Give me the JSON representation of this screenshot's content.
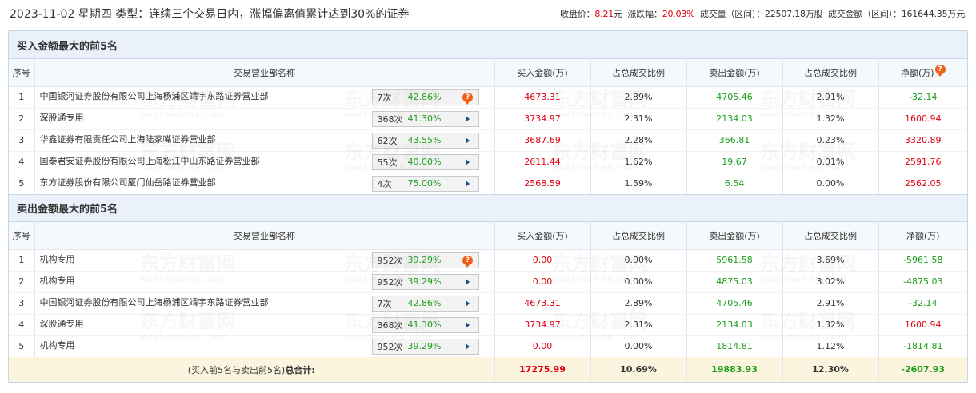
{
  "header": {
    "left_text": "2023-11-02 星期四 类型：连续三个交易日内，涨幅偏离值累计达到30%的证券",
    "close_label": "收盘价：",
    "close_value": "8.21",
    "close_unit": "元",
    "change_label": "涨跌幅：",
    "change_value": "20.03%",
    "volume_text": "成交量（区间）：22507.18万股",
    "turnover_text": "成交金额（区间）：161644.35万元"
  },
  "buy_section": {
    "title": "买入金额最大的前5名",
    "columns": [
      "序号",
      "交易营业部名称",
      "买入金额(万)",
      "占总成交比例",
      "卖出金额(万)",
      "占总成交比例",
      "净额(万)"
    ],
    "rows": [
      {
        "seq": "1",
        "name": "中国银河证券股份有限公司上海杨浦区靖宇东路证券营业部",
        "count": "7次",
        "rate": "42.86%",
        "icon": "question-bubble-icon",
        "buy": "4673.31",
        "buy_pct": "2.89%",
        "sell": "4705.46",
        "sell_pct": "2.91%",
        "net": "-32.14"
      },
      {
        "seq": "2",
        "name": "深股通专用",
        "count": "368次",
        "rate": "41.30%",
        "icon": "arrow-right-icon",
        "buy": "3734.97",
        "buy_pct": "2.31%",
        "sell": "2134.03",
        "sell_pct": "1.32%",
        "net": "1600.94"
      },
      {
        "seq": "3",
        "name": "华鑫证券有限责任公司上海陆家嘴证券营业部",
        "count": "62次",
        "rate": "43.55%",
        "icon": "arrow-right-icon",
        "buy": "3687.69",
        "buy_pct": "2.28%",
        "sell": "366.81",
        "sell_pct": "0.23%",
        "net": "3320.89"
      },
      {
        "seq": "4",
        "name": "国泰君安证券股份有限公司上海松江中山东路证券营业部",
        "count": "55次",
        "rate": "40.00%",
        "icon": "arrow-right-icon",
        "buy": "2611.44",
        "buy_pct": "1.62%",
        "sell": "19.67",
        "sell_pct": "0.01%",
        "net": "2591.76"
      },
      {
        "seq": "5",
        "name": "东方证券股份有限公司厦门仙岳路证券营业部",
        "count": "4次",
        "rate": "75.00%",
        "icon": "arrow-right-icon",
        "buy": "2568.59",
        "buy_pct": "1.59%",
        "sell": "6.54",
        "sell_pct": "0.00%",
        "net": "2562.05"
      }
    ]
  },
  "sell_section": {
    "title": "卖出金额最大的前5名",
    "columns": [
      "序号",
      "交易营业部名称",
      "买入金额(万)",
      "占总成交比例",
      "卖出金额(万)",
      "占总成交比例",
      "净额(万)"
    ],
    "rows": [
      {
        "seq": "1",
        "name": "机构专用",
        "count": "952次",
        "rate": "39.29%",
        "icon": "question-bubble-icon",
        "buy": "0.00",
        "buy_pct": "0.00%",
        "sell": "5961.58",
        "sell_pct": "3.69%",
        "net": "-5961.58"
      },
      {
        "seq": "2",
        "name": "机构专用",
        "count": "952次",
        "rate": "39.29%",
        "icon": "arrow-right-icon",
        "buy": "0.00",
        "buy_pct": "0.00%",
        "sell": "4875.03",
        "sell_pct": "3.02%",
        "net": "-4875.03"
      },
      {
        "seq": "3",
        "name": "中国银河证券股份有限公司上海杨浦区靖宇东路证券营业部",
        "count": "7次",
        "rate": "42.86%",
        "icon": "arrow-right-icon",
        "buy": "4673.31",
        "buy_pct": "2.89%",
        "sell": "4705.46",
        "sell_pct": "2.91%",
        "net": "-32.14"
      },
      {
        "seq": "4",
        "name": "深股通专用",
        "count": "368次",
        "rate": "41.30%",
        "icon": "arrow-right-icon",
        "buy": "3734.97",
        "buy_pct": "2.31%",
        "sell": "2134.03",
        "sell_pct": "1.32%",
        "net": "1600.94"
      },
      {
        "seq": "5",
        "name": "机构专用",
        "count": "952次",
        "rate": "39.29%",
        "icon": "arrow-right-icon",
        "buy": "0.00",
        "buy_pct": "0.00%",
        "sell": "1814.81",
        "sell_pct": "1.12%",
        "net": "-1814.81"
      }
    ],
    "total": {
      "label_prefix": "(买入前5名与卖出前5名)",
      "label_bold": "总合计:",
      "buy": "17275.99",
      "buy_pct": "10.69%",
      "sell": "19883.93",
      "sell_pct": "12.30%",
      "net": "-2607.93"
    }
  },
  "watermark": {
    "cn": "东方财富网",
    "en": "eastmoney.com"
  },
  "colors": {
    "up": "#e0000f",
    "down": "#1b9e1b",
    "header_bg": "#eaf1fb",
    "total_bg": "#fbf5df"
  },
  "net_header_icon": "question-bubble-icon"
}
